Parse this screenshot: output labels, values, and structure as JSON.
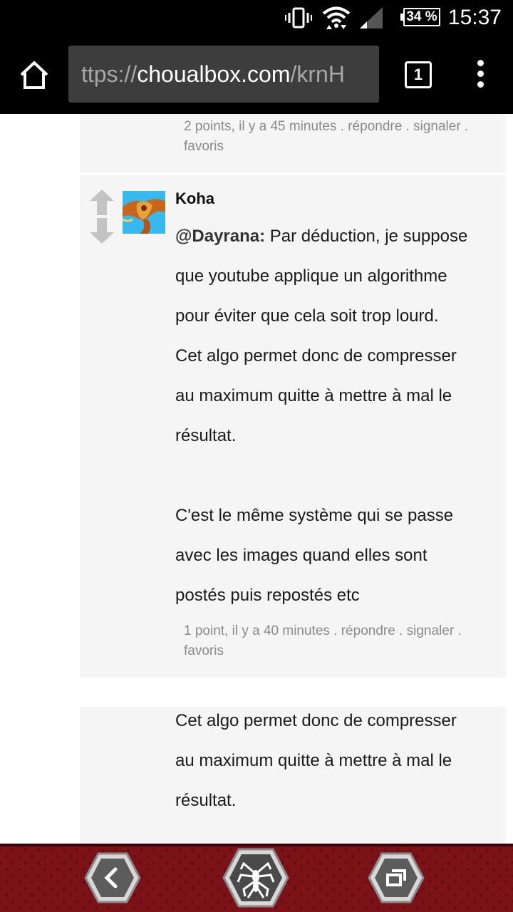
{
  "status_bar": {
    "battery": "34 %",
    "time": "15:37",
    "icons": [
      "vibrate-icon",
      "wifi-icon",
      "signal-icon",
      "battery-icon"
    ]
  },
  "browser": {
    "url_prefix": "ttps://",
    "url_host": "choualbox.com",
    "url_suffix": "/krnH",
    "tab_count": "1"
  },
  "comments": [
    {
      "meta_line1": "2 points, il y a 45 minutes . répondre . signaler .",
      "meta_line2": "favoris"
    },
    {
      "author": "Koha",
      "mention": "@Dayrana:",
      "lines": [
        " Par déduction, je suppose",
        "que youtube applique un algorithme",
        "pour éviter que cela soit trop lourd.",
        "Cet algo permet donc de compresser",
        "au maximum quitte à mettre à mal le",
        "résultat.",
        "",
        "C'est le même système qui se passe",
        "avec les images quand elles sont",
        "postés puis repostés etc"
      ],
      "meta_line1": "1 point, il y a 40 minutes . répondre . signaler .",
      "meta_line2": "favoris"
    },
    {
      "lines": [
        "Cet algo permet donc de compresser",
        "au maximum quitte à mettre à mal le",
        "résultat."
      ]
    }
  ],
  "nav": {
    "buttons": [
      "back-icon",
      "spider-logo-icon",
      "recents-icon"
    ]
  },
  "colors": {
    "panel_bg": "#f4f5f4",
    "meta_text": "#8a8a8a",
    "navbar_red": "#5a0c10"
  }
}
